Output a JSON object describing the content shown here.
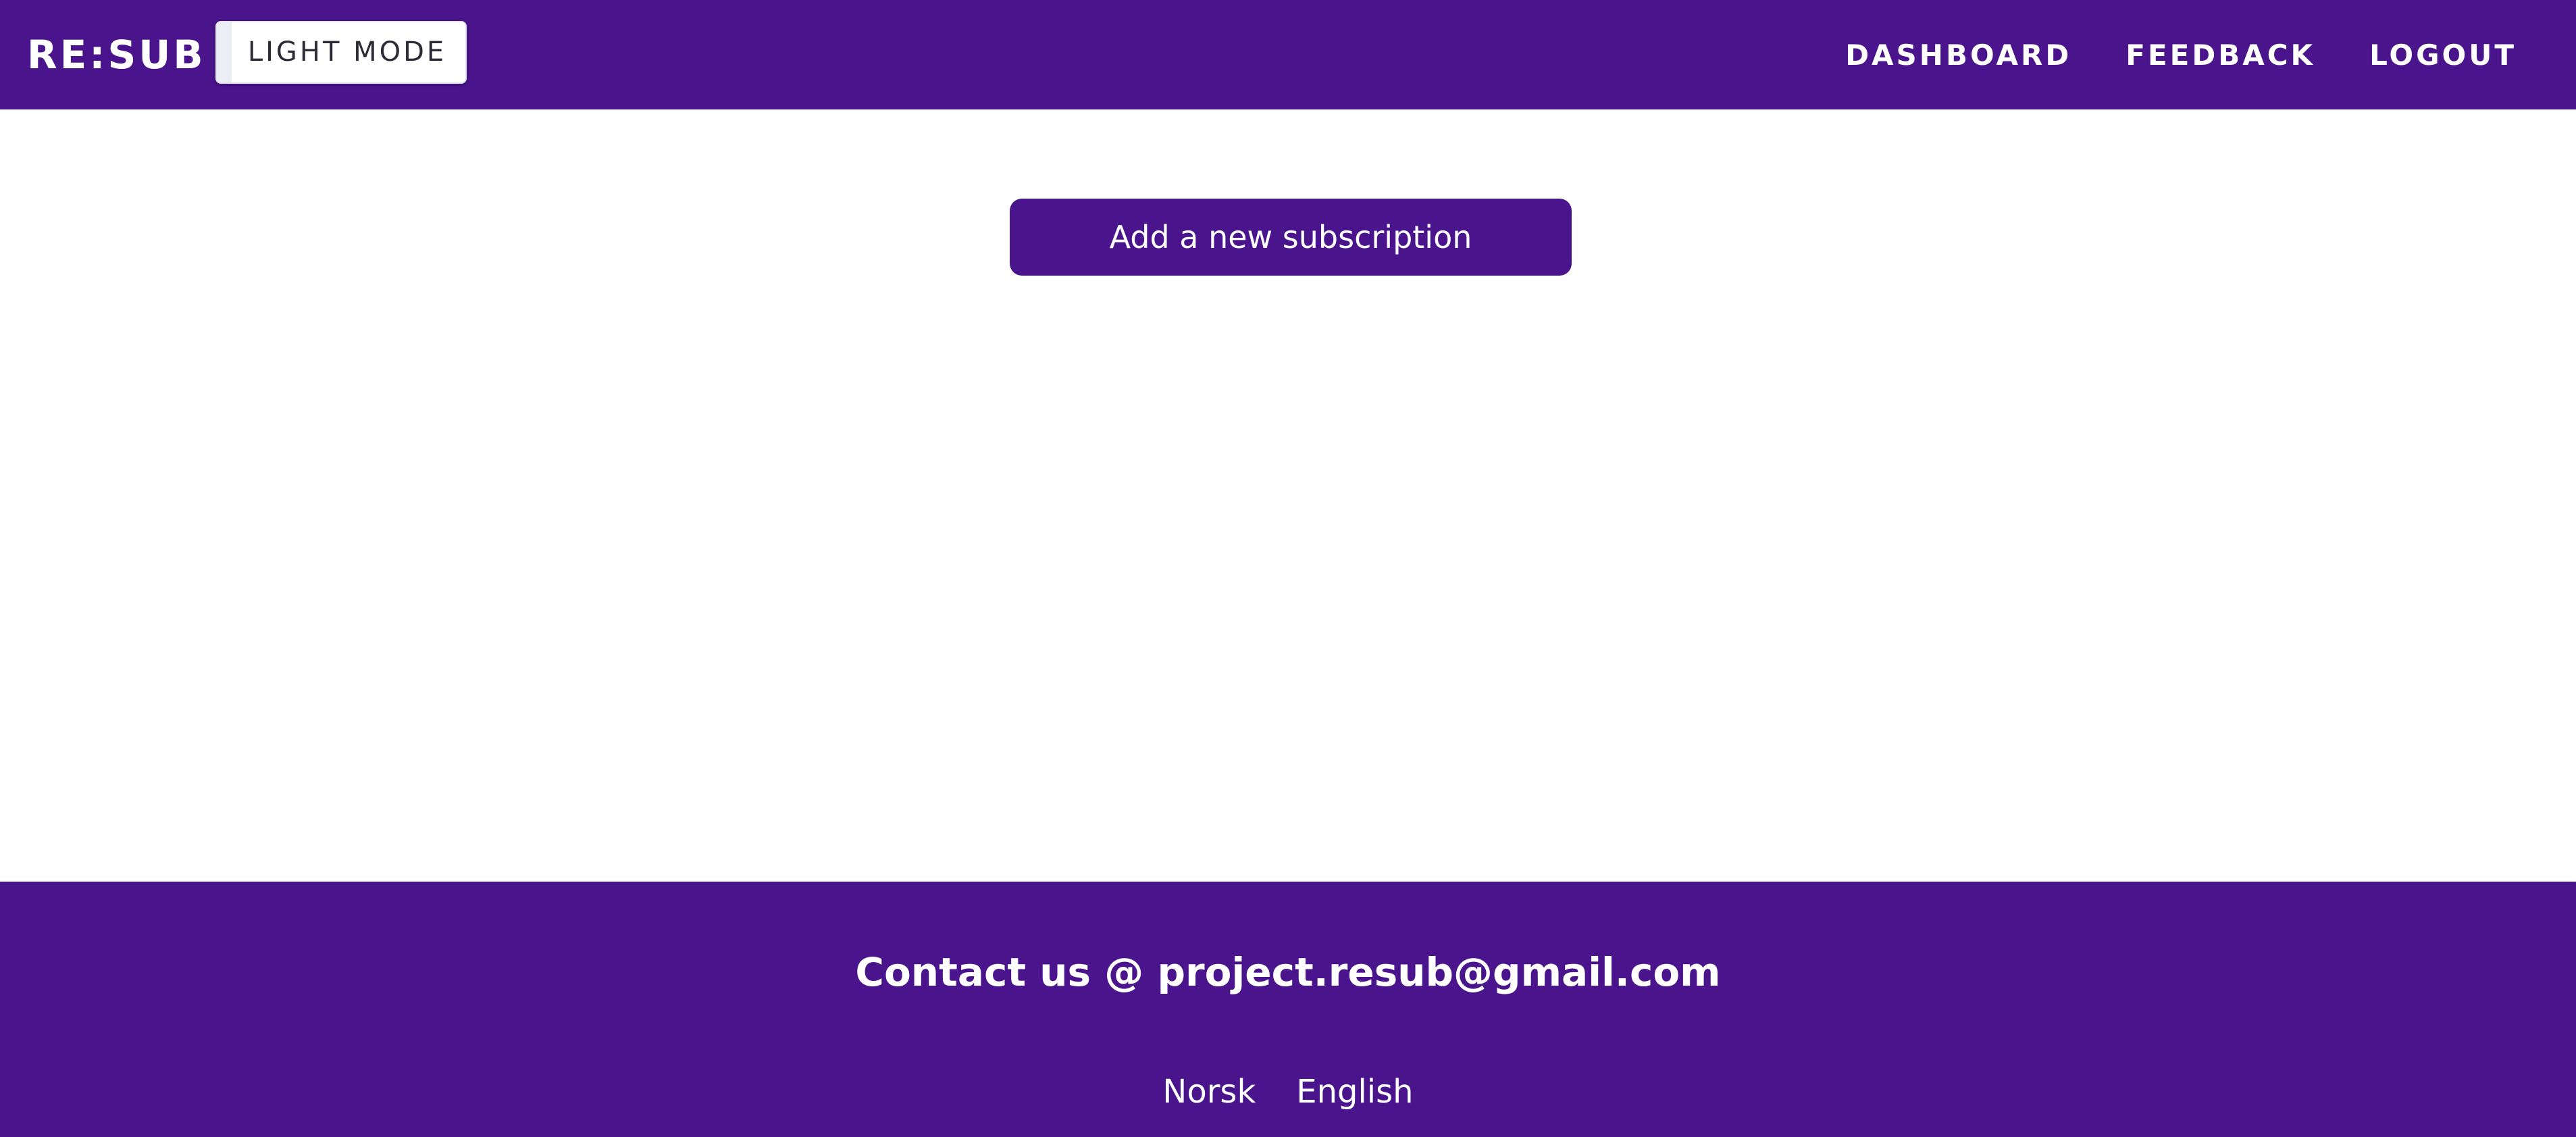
{
  "header": {
    "brand": "RE:SUB",
    "mode_toggle_label": "LIGHT MODE",
    "nav": [
      {
        "label": "DASHBOARD"
      },
      {
        "label": "FEEDBACK"
      },
      {
        "label": "LOGOUT"
      }
    ]
  },
  "main": {
    "add_subscription_label": "Add a new subscription"
  },
  "footer": {
    "contact": "Contact us @ project.resub@gmail.com",
    "languages": [
      {
        "label": "Norsk"
      },
      {
        "label": "English"
      }
    ]
  },
  "colors": {
    "primary": "#4a148c",
    "text_on_primary": "#ffffff",
    "background": "#ffffff"
  }
}
